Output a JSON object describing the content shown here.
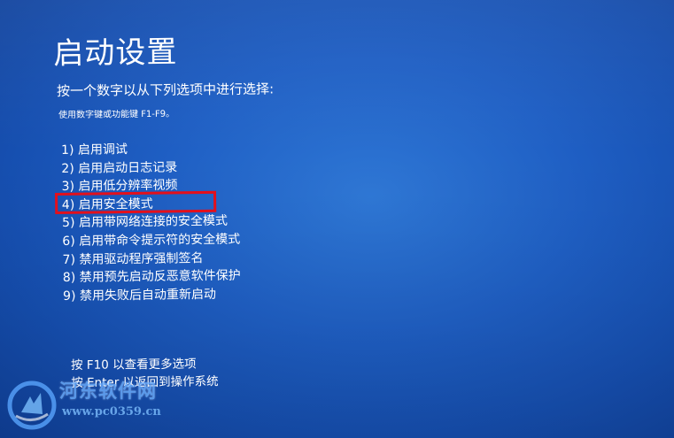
{
  "screen": {
    "title": "启动设置",
    "instruction": "按一个数字以从下列选项中进行选择:",
    "hint": "使用数字键或功能键 F1-F9。"
  },
  "options": [
    {
      "label": "1) 启用调试"
    },
    {
      "label": "2) 启用启动日志记录"
    },
    {
      "label": "3) 启用低分辨率视频"
    },
    {
      "label": "4) 启用安全模式"
    },
    {
      "label": "5) 启用带网络连接的安全模式"
    },
    {
      "label": "6) 启用带命令提示符的安全模式"
    },
    {
      "label": "7) 禁用驱动程序强制签名"
    },
    {
      "label": "8) 禁用预先启动反恶意软件保护"
    },
    {
      "label": "9) 禁用失败后自动重新启动"
    }
  ],
  "highlighted_option_index": 3,
  "footer": {
    "more_options": "按 F10 以查看更多选项",
    "return_os": "按 Enter 以返回到操作系统"
  },
  "watermark": {
    "name": "河东软件网",
    "url": "www.pc0359.cn",
    "logo_icon": "watermark-logo-icon"
  },
  "colors": {
    "background": "#1f5fc4",
    "text": "#ffffff",
    "highlight_border": "#e3101c",
    "watermark": "#6fb1ff"
  }
}
